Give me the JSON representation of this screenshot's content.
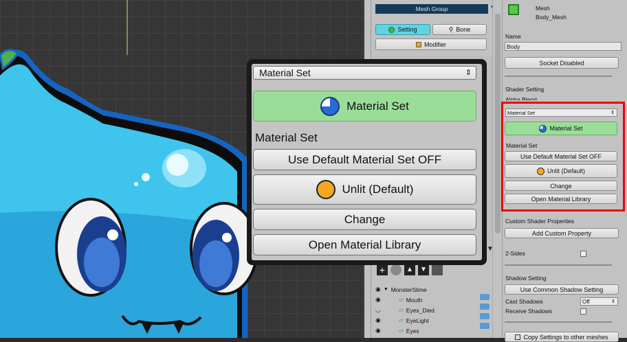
{
  "middle": {
    "header": "Mesh Group",
    "tab_setting": "Setting",
    "tab_bone": "Bone",
    "modifier": "Modifier",
    "hierarchy_root": "MonsterSlime",
    "hierarchy_items": [
      "Mouth",
      "Eyes_Died",
      "EyeLight",
      "Eyes"
    ]
  },
  "right": {
    "object_type": "Mesh",
    "object_name": "Body_Mesh",
    "name_label": "Name",
    "name_value": "Body",
    "socket_button": "Socket Disabled",
    "shader_setting": "Shader Setting",
    "shader_partial": "Alpha Blend",
    "material_set_select": "Material Set",
    "material_set_button": "Material Set",
    "material_set_label": "Material Set",
    "use_default": "Use Default Material Set OFF",
    "unlit": "Unlit (Default)",
    "change": "Change",
    "open_library": "Open Material Library",
    "custom_shader_props": "Custom Shader Properties",
    "add_custom": "Add Custom Property",
    "two_sides": "2-Sides",
    "shadow_setting": "Shadow Setting",
    "use_common_shadow": "Use Common Shadow Setting",
    "cast_shadows": "Cast Shadows",
    "cast_value": "Off",
    "receive_shadows": "Receive Shadows",
    "copy_settings": "Copy Settings to other meshes"
  },
  "zoom": {
    "select": "Material Set",
    "material_set_button": "Material Set",
    "material_set_label": "Material Set",
    "use_default": "Use Default Material Set OFF",
    "unlit": "Unlit (Default)",
    "change": "Change",
    "open_library": "Open Material Library"
  },
  "colors": {
    "highlight": "#ee0000",
    "green_button": "#99dd99",
    "tab_active": "#5fd4e4",
    "mesh_icon": "#55cc44"
  }
}
